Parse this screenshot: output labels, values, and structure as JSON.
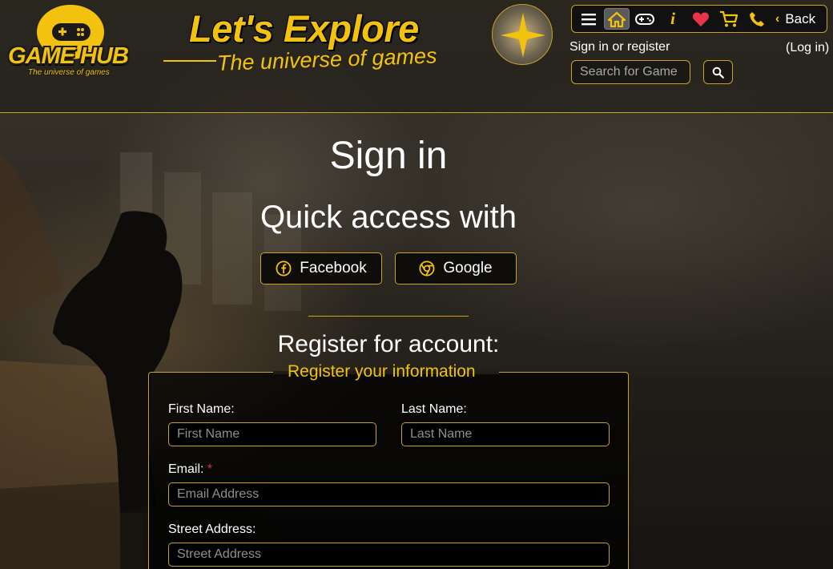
{
  "header": {
    "logo_text": "GAME HUB",
    "logo_tagline": "The universe of games",
    "hero_title": "Let's Explore",
    "hero_subtitle": "The universe of games",
    "toolbar": {
      "icons": [
        "menu-icon",
        "home-icon",
        "gamepad-icon",
        "info-icon",
        "heart-icon",
        "cart-icon",
        "phone-icon"
      ],
      "info_glyph": "i",
      "back_label": "Back"
    },
    "signin_register": "Sign in or register",
    "login_link": "(Log in)",
    "search_placeholder": "Search for Game"
  },
  "main": {
    "title": "Sign in",
    "quick_access": "Quick access with",
    "social": {
      "facebook": "Facebook",
      "google": "Google"
    },
    "register_title": "Register for account:",
    "form": {
      "legend": "Register your information",
      "first_name_label": "First Name:",
      "first_name_placeholder": "First Name",
      "last_name_label": "Last Name:",
      "last_name_placeholder": "Last Name",
      "email_label": "Email:",
      "email_required": "*",
      "email_placeholder": "Email Address",
      "street_label": "Street Address:",
      "street_placeholder": "Street Address"
    }
  },
  "colors": {
    "accent": "#f3c20f",
    "border": "#c9a227",
    "required": "#e03131"
  }
}
